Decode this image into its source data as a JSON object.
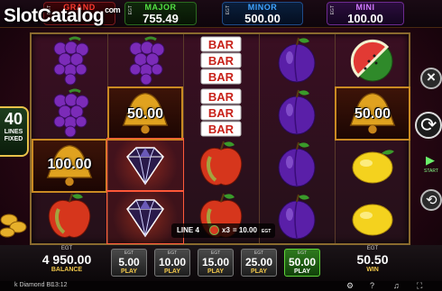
{
  "logo": {
    "text": "SlotCatalog",
    "suffix": "com"
  },
  "jackpots": [
    {
      "name": "GRAND",
      "value": "",
      "brand": "EGT",
      "color": "#ff3b2f"
    },
    {
      "name": "MAJOR",
      "value": "755.49",
      "brand": "EGT",
      "color": "#53e043"
    },
    {
      "name": "MINOR",
      "value": "500.00",
      "brand": "EGT",
      "color": "#3fa3ff"
    },
    {
      "name": "MINI",
      "value": "100.00",
      "brand": "EGT",
      "color": "#d27bff"
    }
  ],
  "lines_badge": {
    "count": "40",
    "line1": "LINES",
    "line2": "FIXED"
  },
  "reels": [
    [
      "grapes",
      "grapes",
      "bell",
      "apple"
    ],
    [
      "grapes",
      "bell",
      "diamond",
      "diamond"
    ],
    [
      "bar",
      "bar",
      "apple",
      "apple"
    ],
    [
      "plum",
      "plum",
      "plum",
      "plum"
    ],
    [
      "watermelon",
      "bell",
      "lemon",
      "lemon"
    ]
  ],
  "bell_values": {
    "reel1": "100.00",
    "reel2": "50.00",
    "reel5": "50.00"
  },
  "bar_label": "BAR",
  "win_line": {
    "line": "LINE 4",
    "multiplier": "x3",
    "amount": "= 10.00",
    "currency": "EGT"
  },
  "balance": {
    "brand": "EGT",
    "value": "4 950.00",
    "label": "BALANCE"
  },
  "bets": [
    {
      "brand": "EGT",
      "value": "5.00",
      "label": "PLAY",
      "active": false
    },
    {
      "brand": "EGT",
      "value": "10.00",
      "label": "PLAY",
      "active": false
    },
    {
      "brand": "EGT",
      "value": "15.00",
      "label": "PLAY",
      "active": false
    },
    {
      "brand": "EGT",
      "value": "25.00",
      "label": "PLAY",
      "active": false
    },
    {
      "brand": "EGT",
      "value": "50.00",
      "label": "PLAY",
      "active": true
    }
  ],
  "win": {
    "brand": "EGT",
    "value": "50.50",
    "label": "WIN"
  },
  "side_buttons": {
    "close": "×",
    "start_label": "START"
  },
  "status": {
    "title": "k Diamond BL",
    "clock": "13:12"
  },
  "icons": [
    "close-icon",
    "spin-icon",
    "play-icon",
    "auto-icon",
    "music-icon",
    "help-icon",
    "settings-icon",
    "fullscreen-icon"
  ]
}
